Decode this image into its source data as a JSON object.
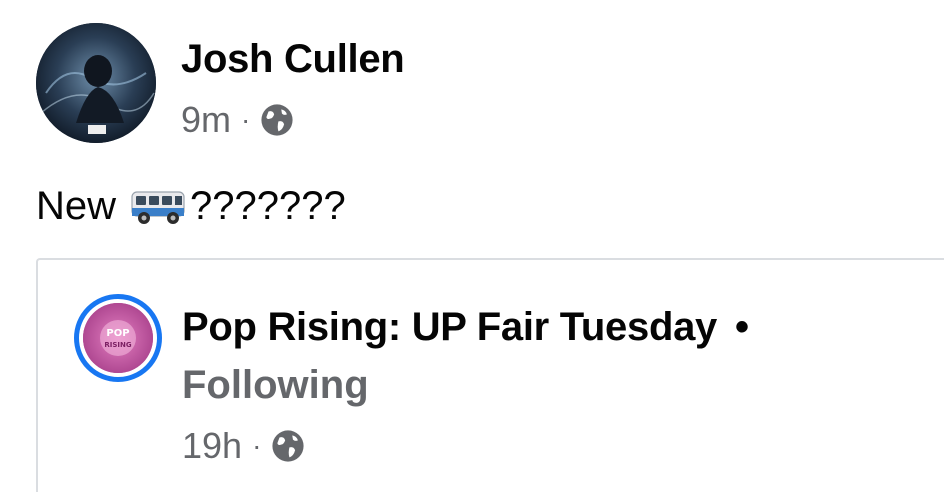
{
  "post": {
    "author_name": "Josh Cullen",
    "time_ago": "9m",
    "separator": "·",
    "privacy_icon": "globe-icon",
    "text_prefix": "New",
    "text_emoji": "minibus-emoji",
    "text_suffix": "???????"
  },
  "shared": {
    "page_name": "Pop Rising: UP Fair Tuesday",
    "bullet": "•",
    "follow_status": "Following",
    "time_ago": "19h",
    "separator": "·",
    "privacy_icon": "globe-icon",
    "avatar_text_top": "POP",
    "avatar_text_bottom": "RISING",
    "ring_color": "#1877f2"
  },
  "colors": {
    "primary_text": "#050505",
    "secondary_text": "#65676b",
    "accent": "#1877f2",
    "divider": "#dadde1"
  }
}
